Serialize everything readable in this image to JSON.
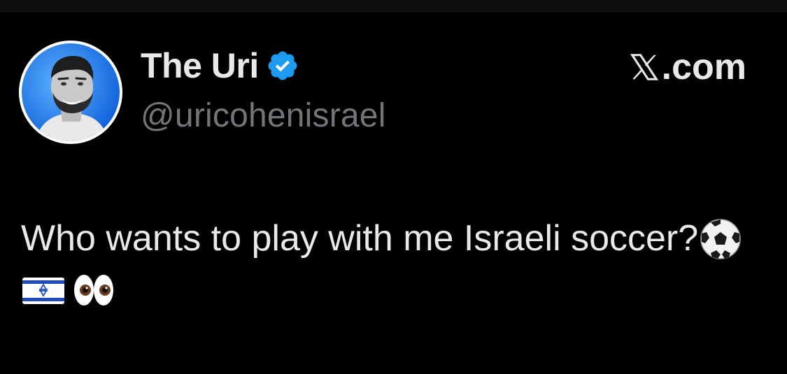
{
  "author": {
    "display_name": "The Uri",
    "handle": "@uricohenisrael",
    "verified": true,
    "avatar": "profile-photo-smiling-man"
  },
  "brand": {
    "site_label": ".com",
    "logo_icon": "x-logo-icon"
  },
  "tweet": {
    "text": "Who wants to play with me Israeli soccer?",
    "emojis": [
      "soccer-ball-icon",
      "israel-flag-icon",
      "eyes-icon"
    ]
  },
  "colors": {
    "background": "#000000",
    "primary_text": "#e7e9ea",
    "secondary_text": "#71767b",
    "verified_blue": "#1d9bf0"
  }
}
